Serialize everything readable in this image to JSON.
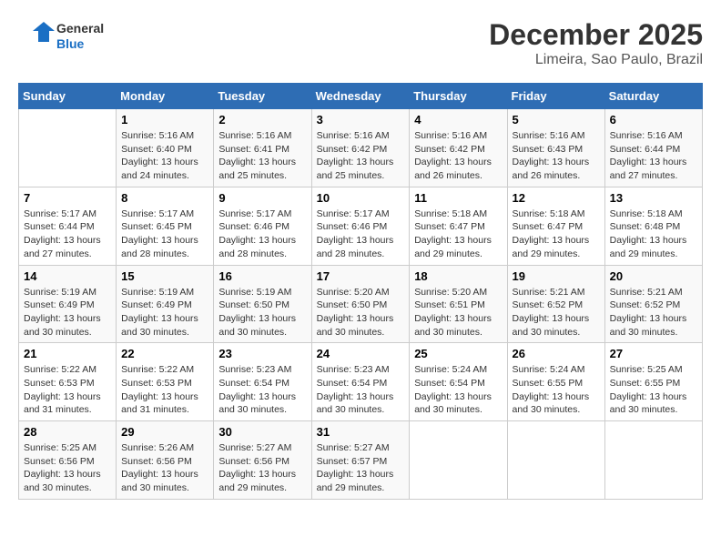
{
  "logo": {
    "general": "General",
    "blue": "Blue"
  },
  "header": {
    "title": "December 2025",
    "subtitle": "Limeira, Sao Paulo, Brazil"
  },
  "days_of_week": [
    "Sunday",
    "Monday",
    "Tuesday",
    "Wednesday",
    "Thursday",
    "Friday",
    "Saturday"
  ],
  "weeks": [
    [
      {
        "day": "",
        "sunrise": "",
        "sunset": "",
        "daylight": ""
      },
      {
        "day": "1",
        "sunrise": "Sunrise: 5:16 AM",
        "sunset": "Sunset: 6:40 PM",
        "daylight": "Daylight: 13 hours and 24 minutes."
      },
      {
        "day": "2",
        "sunrise": "Sunrise: 5:16 AM",
        "sunset": "Sunset: 6:41 PM",
        "daylight": "Daylight: 13 hours and 25 minutes."
      },
      {
        "day": "3",
        "sunrise": "Sunrise: 5:16 AM",
        "sunset": "Sunset: 6:42 PM",
        "daylight": "Daylight: 13 hours and 25 minutes."
      },
      {
        "day": "4",
        "sunrise": "Sunrise: 5:16 AM",
        "sunset": "Sunset: 6:42 PM",
        "daylight": "Daylight: 13 hours and 26 minutes."
      },
      {
        "day": "5",
        "sunrise": "Sunrise: 5:16 AM",
        "sunset": "Sunset: 6:43 PM",
        "daylight": "Daylight: 13 hours and 26 minutes."
      },
      {
        "day": "6",
        "sunrise": "Sunrise: 5:16 AM",
        "sunset": "Sunset: 6:44 PM",
        "daylight": "Daylight: 13 hours and 27 minutes."
      }
    ],
    [
      {
        "day": "7",
        "sunrise": "Sunrise: 5:17 AM",
        "sunset": "Sunset: 6:44 PM",
        "daylight": "Daylight: 13 hours and 27 minutes."
      },
      {
        "day": "8",
        "sunrise": "Sunrise: 5:17 AM",
        "sunset": "Sunset: 6:45 PM",
        "daylight": "Daylight: 13 hours and 28 minutes."
      },
      {
        "day": "9",
        "sunrise": "Sunrise: 5:17 AM",
        "sunset": "Sunset: 6:46 PM",
        "daylight": "Daylight: 13 hours and 28 minutes."
      },
      {
        "day": "10",
        "sunrise": "Sunrise: 5:17 AM",
        "sunset": "Sunset: 6:46 PM",
        "daylight": "Daylight: 13 hours and 28 minutes."
      },
      {
        "day": "11",
        "sunrise": "Sunrise: 5:18 AM",
        "sunset": "Sunset: 6:47 PM",
        "daylight": "Daylight: 13 hours and 29 minutes."
      },
      {
        "day": "12",
        "sunrise": "Sunrise: 5:18 AM",
        "sunset": "Sunset: 6:47 PM",
        "daylight": "Daylight: 13 hours and 29 minutes."
      },
      {
        "day": "13",
        "sunrise": "Sunrise: 5:18 AM",
        "sunset": "Sunset: 6:48 PM",
        "daylight": "Daylight: 13 hours and 29 minutes."
      }
    ],
    [
      {
        "day": "14",
        "sunrise": "Sunrise: 5:19 AM",
        "sunset": "Sunset: 6:49 PM",
        "daylight": "Daylight: 13 hours and 30 minutes."
      },
      {
        "day": "15",
        "sunrise": "Sunrise: 5:19 AM",
        "sunset": "Sunset: 6:49 PM",
        "daylight": "Daylight: 13 hours and 30 minutes."
      },
      {
        "day": "16",
        "sunrise": "Sunrise: 5:19 AM",
        "sunset": "Sunset: 6:50 PM",
        "daylight": "Daylight: 13 hours and 30 minutes."
      },
      {
        "day": "17",
        "sunrise": "Sunrise: 5:20 AM",
        "sunset": "Sunset: 6:50 PM",
        "daylight": "Daylight: 13 hours and 30 minutes."
      },
      {
        "day": "18",
        "sunrise": "Sunrise: 5:20 AM",
        "sunset": "Sunset: 6:51 PM",
        "daylight": "Daylight: 13 hours and 30 minutes."
      },
      {
        "day": "19",
        "sunrise": "Sunrise: 5:21 AM",
        "sunset": "Sunset: 6:52 PM",
        "daylight": "Daylight: 13 hours and 30 minutes."
      },
      {
        "day": "20",
        "sunrise": "Sunrise: 5:21 AM",
        "sunset": "Sunset: 6:52 PM",
        "daylight": "Daylight: 13 hours and 30 minutes."
      }
    ],
    [
      {
        "day": "21",
        "sunrise": "Sunrise: 5:22 AM",
        "sunset": "Sunset: 6:53 PM",
        "daylight": "Daylight: 13 hours and 31 minutes."
      },
      {
        "day": "22",
        "sunrise": "Sunrise: 5:22 AM",
        "sunset": "Sunset: 6:53 PM",
        "daylight": "Daylight: 13 hours and 31 minutes."
      },
      {
        "day": "23",
        "sunrise": "Sunrise: 5:23 AM",
        "sunset": "Sunset: 6:54 PM",
        "daylight": "Daylight: 13 hours and 30 minutes."
      },
      {
        "day": "24",
        "sunrise": "Sunrise: 5:23 AM",
        "sunset": "Sunset: 6:54 PM",
        "daylight": "Daylight: 13 hours and 30 minutes."
      },
      {
        "day": "25",
        "sunrise": "Sunrise: 5:24 AM",
        "sunset": "Sunset: 6:54 PM",
        "daylight": "Daylight: 13 hours and 30 minutes."
      },
      {
        "day": "26",
        "sunrise": "Sunrise: 5:24 AM",
        "sunset": "Sunset: 6:55 PM",
        "daylight": "Daylight: 13 hours and 30 minutes."
      },
      {
        "day": "27",
        "sunrise": "Sunrise: 5:25 AM",
        "sunset": "Sunset: 6:55 PM",
        "daylight": "Daylight: 13 hours and 30 minutes."
      }
    ],
    [
      {
        "day": "28",
        "sunrise": "Sunrise: 5:25 AM",
        "sunset": "Sunset: 6:56 PM",
        "daylight": "Daylight: 13 hours and 30 minutes."
      },
      {
        "day": "29",
        "sunrise": "Sunrise: 5:26 AM",
        "sunset": "Sunset: 6:56 PM",
        "daylight": "Daylight: 13 hours and 30 minutes."
      },
      {
        "day": "30",
        "sunrise": "Sunrise: 5:27 AM",
        "sunset": "Sunset: 6:56 PM",
        "daylight": "Daylight: 13 hours and 29 minutes."
      },
      {
        "day": "31",
        "sunrise": "Sunrise: 5:27 AM",
        "sunset": "Sunset: 6:57 PM",
        "daylight": "Daylight: 13 hours and 29 minutes."
      },
      {
        "day": "",
        "sunrise": "",
        "sunset": "",
        "daylight": ""
      },
      {
        "day": "",
        "sunrise": "",
        "sunset": "",
        "daylight": ""
      },
      {
        "day": "",
        "sunrise": "",
        "sunset": "",
        "daylight": ""
      }
    ]
  ]
}
